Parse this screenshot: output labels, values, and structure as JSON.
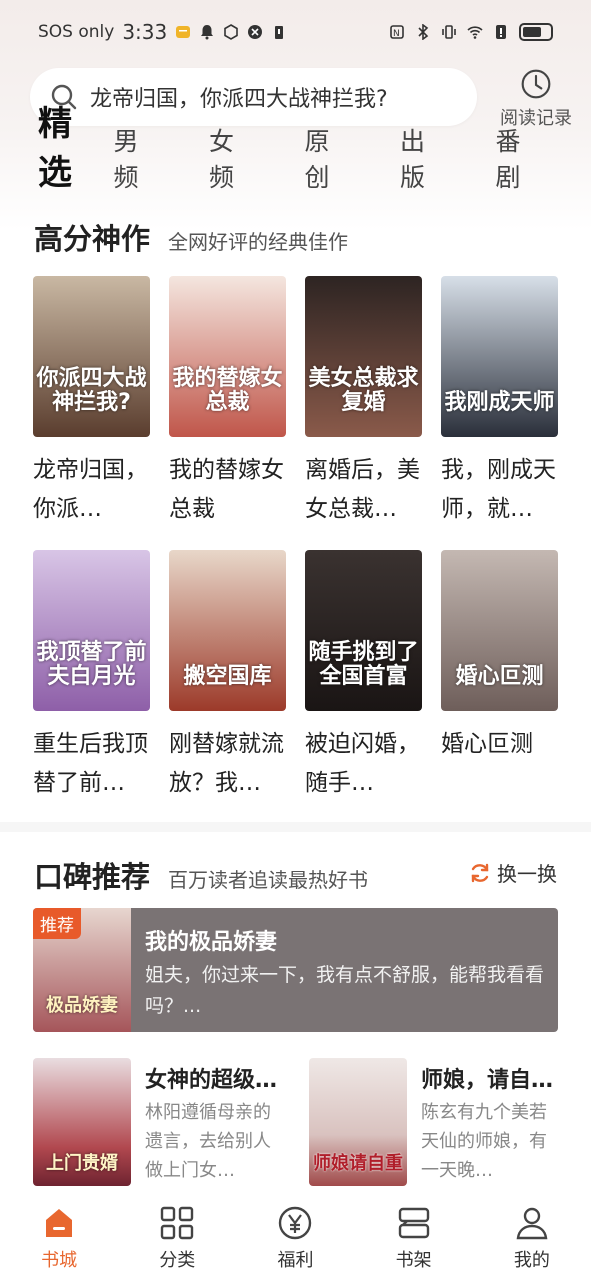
{
  "status_bar": {
    "carrier": "SOS only",
    "time": "3:33"
  },
  "search": {
    "placeholder": "龙帝归国，你派四大战神拦我?",
    "history_label": "阅读记录"
  },
  "tabs": [
    "精选",
    "男频",
    "女频",
    "原创",
    "出版",
    "番剧"
  ],
  "section1": {
    "title": "高分神作",
    "subtitle": "全网好评的经典佳作",
    "books": [
      {
        "title": "龙帝归国，你派…",
        "cover_text": "你派四大战神拦我?",
        "color_top": "#c9b8a3",
        "color_bottom": "#5a3d2e"
      },
      {
        "title": "我的替嫁女总裁",
        "cover_text": "我的替嫁女总裁",
        "color_top": "#f4e6df",
        "color_bottom": "#c0564a"
      },
      {
        "title": "离婚后，美女总裁…",
        "cover_text": "美女总裁求复婚",
        "color_top": "#2d2422",
        "color_bottom": "#8a5a4a"
      },
      {
        "title": "我，刚成天师，就…",
        "cover_text": "我刚成天师",
        "color_top": "#d7dfe8",
        "color_bottom": "#2a2f3a"
      },
      {
        "title": "重生后我顶替了前…",
        "cover_text": "我顶替了前夫白月光",
        "color_top": "#d8c5e6",
        "color_bottom": "#8e5fa8"
      },
      {
        "title": "刚替嫁就流放？我…",
        "cover_text": "搬空国库",
        "color_top": "#e8d7c9",
        "color_bottom": "#9c3a2a"
      },
      {
        "title": "被迫闪婚，随手…",
        "cover_text": "随手挑到了全国首富",
        "color_top": "#3a3230",
        "color_bottom": "#1a1514"
      },
      {
        "title": "婚心叵测",
        "cover_text": "婚心叵测",
        "color_top": "#c4b8b2",
        "color_bottom": "#6e5e5a"
      }
    ]
  },
  "section2": {
    "title": "口碑推荐",
    "subtitle": "百万读者追读最热好书",
    "refresh_label": "换一换",
    "featured": {
      "badge": "推荐",
      "title": "我的极品娇妻",
      "desc": "姐夫，你过来一下，我有点不舒服，能帮我看看吗？...",
      "cover_text": "极品娇妻"
    },
    "items": [
      {
        "title": "女神的超级…",
        "desc": "林阳遵循母亲的遗言，去给别人做上门女…",
        "cover_text": "上门贵婿"
      },
      {
        "title": "师娘，请自…",
        "desc": "陈玄有九个美若天仙的师娘，有一天晚…",
        "cover_text": "师娘请自重"
      }
    ]
  },
  "bottom_nav": [
    {
      "label": "书城",
      "active": true
    },
    {
      "label": "分类",
      "active": false
    },
    {
      "label": "福利",
      "active": false
    },
    {
      "label": "书架",
      "active": false
    },
    {
      "label": "我的",
      "active": false
    }
  ],
  "colors": {
    "accent": "#e8672f",
    "badge": "#e85a2a",
    "featured_bg": "#7a7374"
  }
}
